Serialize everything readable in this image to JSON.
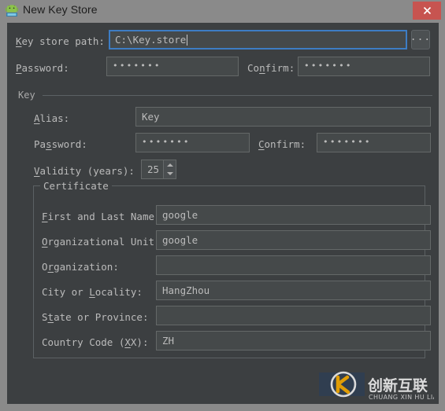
{
  "window": {
    "title": "New Key Store",
    "icon": "android-robot-icon",
    "close_label": "✕",
    "frame_color": "#8a8a8a",
    "dialog_bg": "#3c3f41",
    "accent_focus": "#3d7dc4",
    "close_color": "#c75450"
  },
  "keystore": {
    "path_label_pre": "",
    "path_label_mnemonic": "K",
    "path_label_post": "ey store path:",
    "path_value": "C:\\Key.store",
    "browse_label": "...",
    "password_label_pre": "",
    "password_label_mnemonic": "P",
    "password_label_post": "assword:",
    "password_value": "•••••••",
    "confirm_label_pre": "Co",
    "confirm_label_mnemonic": "n",
    "confirm_label_post": "firm:",
    "confirm_value": "•••••••"
  },
  "key_group": {
    "title": "Key",
    "alias_label_pre": "",
    "alias_label_mnemonic": "A",
    "alias_label_post": "lias:",
    "alias_value": "Key",
    "password_label_pre": "Pa",
    "password_label_mnemonic": "s",
    "password_label_post": "sword:",
    "password_value": "•••••••",
    "confirm_label_pre": "",
    "confirm_label_mnemonic": "C",
    "confirm_label_post": "onfirm:",
    "confirm_value": "•••••••",
    "validity_label_pre": "",
    "validity_label_mnemonic": "V",
    "validity_label_post": "alidity (years):",
    "validity_value": "25"
  },
  "certificate": {
    "title": "Certificate",
    "fields": [
      {
        "label_pre": "",
        "label_mnemonic": "F",
        "label_post": "irst and Last Name:",
        "value": "google"
      },
      {
        "label_pre": "",
        "label_mnemonic": "O",
        "label_post": "rganizational Unit:",
        "value": "google"
      },
      {
        "label_pre": "O",
        "label_mnemonic": "r",
        "label_post": "ganization:",
        "value": ""
      },
      {
        "label_pre": "City or ",
        "label_mnemonic": "L",
        "label_post": "ocality:",
        "value": "HangZhou"
      },
      {
        "label_pre": "S",
        "label_mnemonic": "t",
        "label_post": "ate or Province:",
        "value": ""
      },
      {
        "label_pre": "Country Code (",
        "label_mnemonic": "X",
        "label_post": "X):",
        "value": "ZH"
      }
    ]
  },
  "watermark": {
    "cn_text": "创新互联",
    "py_text": "CHUANG XIN HU LIAN",
    "logo": "cxhl-circle-logo"
  }
}
